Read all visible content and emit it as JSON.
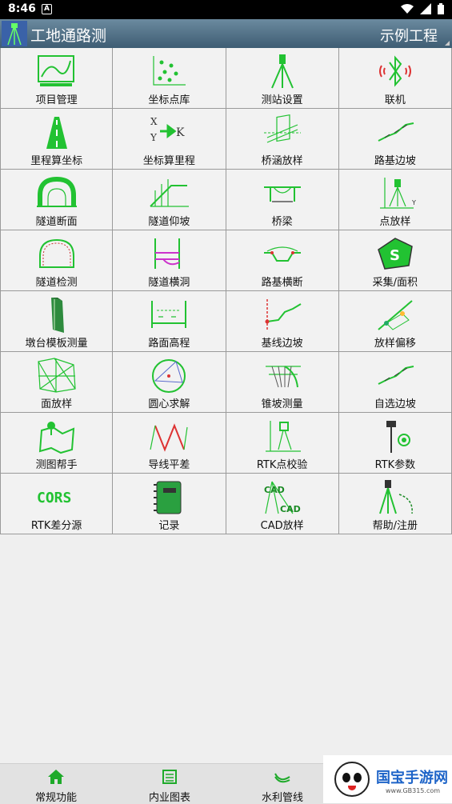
{
  "status_bar": {
    "time": "8:46",
    "notif_letter": "A"
  },
  "title_bar": {
    "app_title": "工地通路测",
    "project": "示例工程"
  },
  "grid": [
    {
      "label": "项目管理",
      "icon": "project-manage"
    },
    {
      "label": "坐标点库",
      "icon": "coord-points"
    },
    {
      "label": "测站设置",
      "icon": "station-setup"
    },
    {
      "label": "联机",
      "icon": "bluetooth"
    },
    {
      "label": "里程算坐标",
      "icon": "road"
    },
    {
      "label": "坐标算里程",
      "icon": "xy-to-k"
    },
    {
      "label": "桥涵放样",
      "icon": "culvert"
    },
    {
      "label": "路基边坡",
      "icon": "slope-line"
    },
    {
      "label": "隧道断面",
      "icon": "tunnel"
    },
    {
      "label": "隧道仰坡",
      "icon": "tunnel-slope"
    },
    {
      "label": "桥梁",
      "icon": "bridge"
    },
    {
      "label": "点放样",
      "icon": "point-stakeout"
    },
    {
      "label": "隧道检测",
      "icon": "tunnel-check"
    },
    {
      "label": "隧道横洞",
      "icon": "tunnel-cross"
    },
    {
      "label": "路基横断",
      "icon": "cross-section"
    },
    {
      "label": "采集/面积",
      "icon": "area-collect"
    },
    {
      "label": "墩台模板测量",
      "icon": "pier"
    },
    {
      "label": "路面高程",
      "icon": "road-elevation"
    },
    {
      "label": "基线边坡",
      "icon": "baseline-slope"
    },
    {
      "label": "放样偏移",
      "icon": "offset"
    },
    {
      "label": "面放样",
      "icon": "surface"
    },
    {
      "label": "圆心求解",
      "icon": "circle-center"
    },
    {
      "label": "锥坡测量",
      "icon": "cone-slope"
    },
    {
      "label": "自选边坡",
      "icon": "custom-slope"
    },
    {
      "label": "测图帮手",
      "icon": "map-helper"
    },
    {
      "label": "导线平差",
      "icon": "traverse"
    },
    {
      "label": "RTK点校验",
      "icon": "rtk-check"
    },
    {
      "label": "RTK参数",
      "icon": "rtk-params"
    },
    {
      "label": "RTK差分源",
      "icon": "cors",
      "icon_text": "CORS"
    },
    {
      "label": "记录",
      "icon": "record-book"
    },
    {
      "label": "CAD放样",
      "icon": "cad",
      "icon_text": "CAD"
    },
    {
      "label": "帮助/注册",
      "icon": "help"
    }
  ],
  "bottom_nav": [
    {
      "label": "常规功能",
      "icon": "home"
    },
    {
      "label": "内业图表",
      "icon": "charts"
    },
    {
      "label": "水利管线",
      "icon": "pipeline"
    }
  ],
  "watermark": {
    "title": "国宝手游网",
    "url": "www.GB315.com"
  },
  "colors": {
    "icon_green": "#22c232",
    "title_bar": "#4f6f86"
  }
}
